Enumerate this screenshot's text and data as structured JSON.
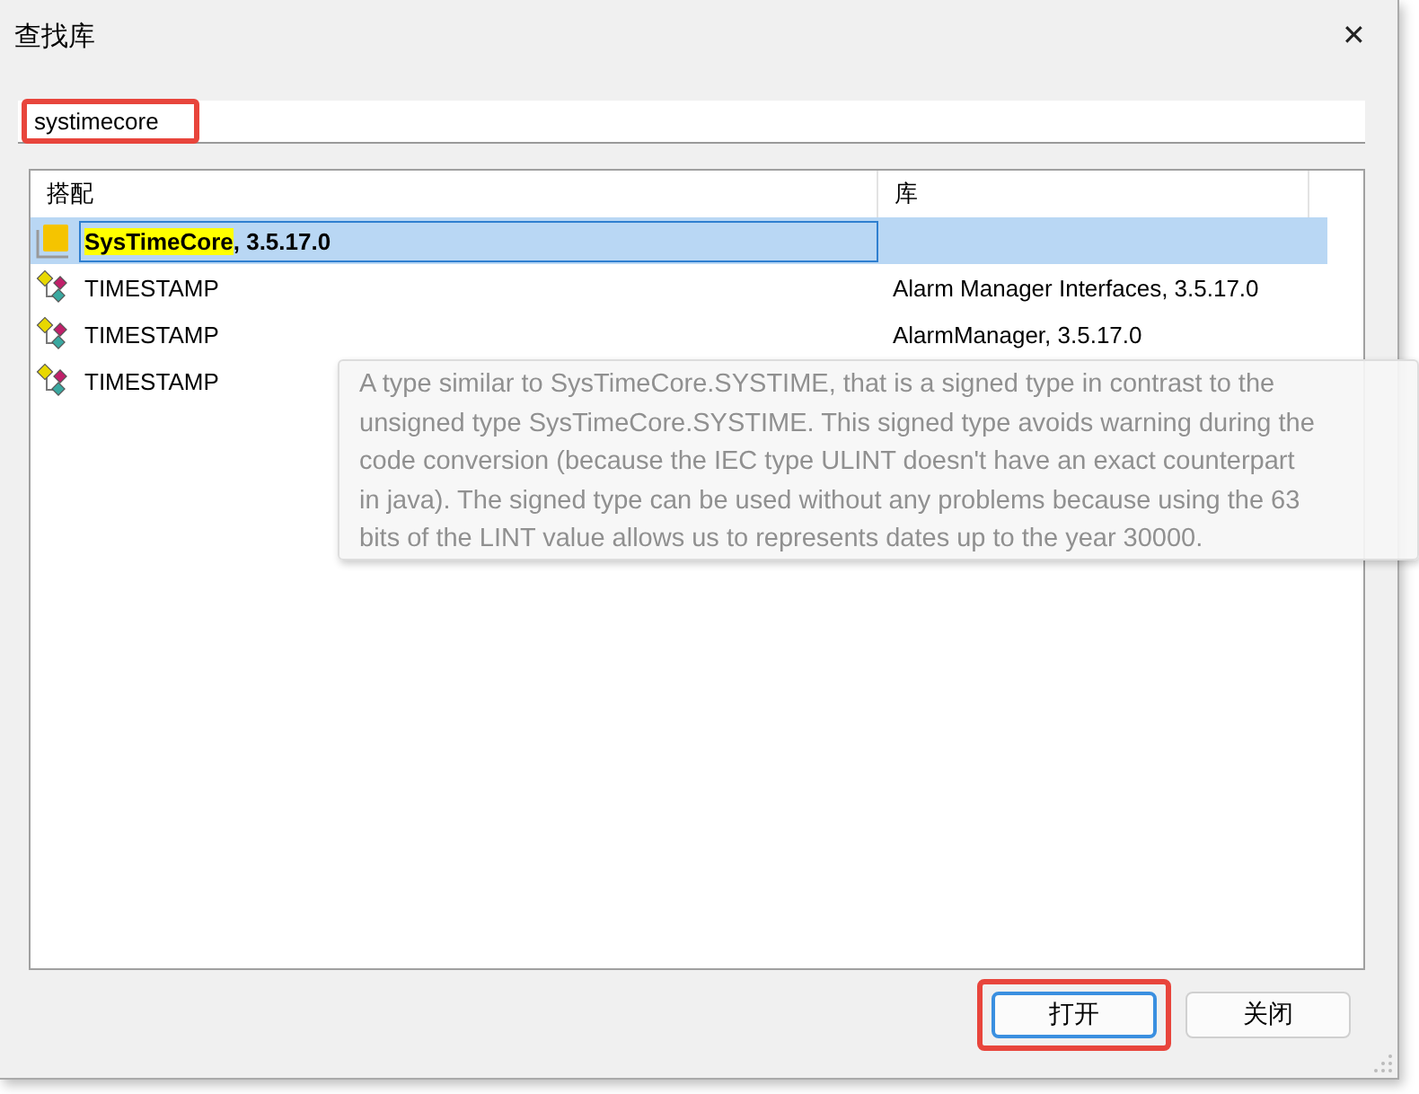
{
  "window": {
    "title": "查找库",
    "close": "✕"
  },
  "search": {
    "value": "systimecore",
    "highlighted": true
  },
  "table": {
    "columns": [
      "搭配",
      "库"
    ],
    "rows": [
      {
        "kind": "library",
        "match": "SysTimeCore",
        "rest": ", 3.5.17.0",
        "library": "",
        "selected": true
      },
      {
        "kind": "type",
        "match": "",
        "rest": "TIMESTAMP",
        "library": "Alarm Manager Interfaces, 3.5.17.0",
        "selected": false
      },
      {
        "kind": "type",
        "match": "",
        "rest": "TIMESTAMP",
        "library": "AlarmManager, 3.5.17.0",
        "selected": false
      },
      {
        "kind": "type",
        "match": "",
        "rest": "TIMESTAMP",
        "library": "",
        "selected": false
      }
    ]
  },
  "tooltip": {
    "lines": [
      "A type similar to SysTimeCore.SYSTIME, that is a signed type in contrast to the",
      "unsigned type SysTimeCore.SYSTIME. This signed type avoids warning during the",
      "code conversion (because the IEC type ULINT doesn't have an exact counterpart",
      "in java). The signed type can be used without any problems because using the 63",
      "bits of the LINT value allows us to represents dates up to the year 30000."
    ]
  },
  "buttons": [
    {
      "label": "打开",
      "highlighted": true,
      "default": true
    },
    {
      "label": "关闭",
      "highlighted": false,
      "default": false
    }
  ]
}
